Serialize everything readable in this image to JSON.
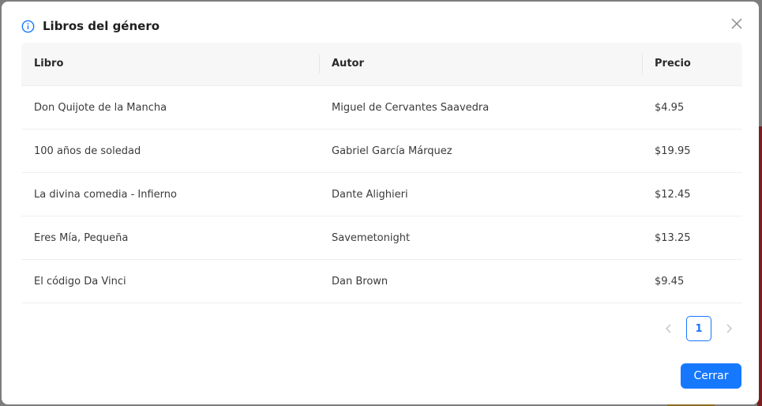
{
  "modal": {
    "title": "Libros del género",
    "close_label": "Cerrar"
  },
  "table": {
    "headers": [
      "Libro",
      "Autor",
      "Precio"
    ],
    "rows": [
      {
        "libro": "Don Quijote de la Mancha",
        "autor": "Miguel de Cervantes Saavedra",
        "precio": "$4.95"
      },
      {
        "libro": "100 años de soledad",
        "autor": "Gabriel García Márquez",
        "precio": "$19.95"
      },
      {
        "libro": "La divina comedia - Infierno",
        "autor": "Dante Alighieri",
        "precio": "$12.45"
      },
      {
        "libro": "Eres Mía, Pequeña",
        "autor": "Savemetonight",
        "precio": "$13.25"
      },
      {
        "libro": "El código Da Vinci",
        "autor": "Dan Brown",
        "precio": "$9.45"
      }
    ]
  },
  "pagination": {
    "current_page": "1",
    "prev_icon": "chevron-left-icon",
    "next_icon": "chevron-right-icon"
  },
  "icons": {
    "header_icon": "info-icon",
    "close_icon": "close-icon"
  },
  "colors": {
    "primary": "#1677ff",
    "header_bg": "#f7f7f7"
  }
}
